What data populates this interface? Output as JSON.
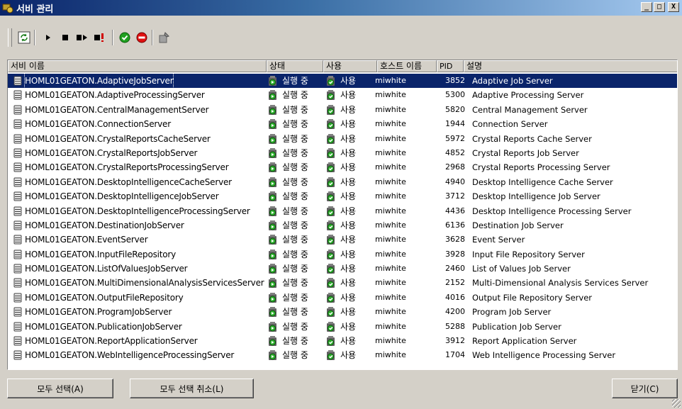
{
  "window": {
    "title": "서비 관리",
    "minimize": "_",
    "maximize": "□",
    "close": "X"
  },
  "toolbar": {
    "icons": [
      "refresh-icon",
      "start-icon",
      "stop-icon",
      "restart-icon",
      "force-stop-icon",
      "enable-icon",
      "disable-icon",
      "properties-icon"
    ]
  },
  "columns": {
    "name": "서비 이름",
    "state": "상태",
    "use": "사용",
    "host": "호스트 이름",
    "pid": "PID",
    "desc": "설명"
  },
  "rows": [
    {
      "name": "HOML01GEATON.AdaptiveJobServer",
      "state": "실행 중",
      "use": "사용",
      "host": "miwhite",
      "pid": "3852",
      "desc": "Adaptive Job Server",
      "selected": true
    },
    {
      "name": "HOML01GEATON.AdaptiveProcessingServer",
      "state": "실행 중",
      "use": "사용",
      "host": "miwhite",
      "pid": "5300",
      "desc": "Adaptive Processing Server"
    },
    {
      "name": "HOML01GEATON.CentralManagementServer",
      "state": "실행 중",
      "use": "사용",
      "host": "miwhite",
      "pid": "5820",
      "desc": "Central Management Server"
    },
    {
      "name": "HOML01GEATON.ConnectionServer",
      "state": "실행 중",
      "use": "사용",
      "host": "miwhite",
      "pid": "1944",
      "desc": "Connection Server"
    },
    {
      "name": "HOML01GEATON.CrystalReportsCacheServer",
      "state": "실행 중",
      "use": "사용",
      "host": "miwhite",
      "pid": "5972",
      "desc": "Crystal Reports Cache Server"
    },
    {
      "name": "HOML01GEATON.CrystalReportsJobServer",
      "state": "실행 중",
      "use": "사용",
      "host": "miwhite",
      "pid": "4852",
      "desc": "Crystal Reports Job Server"
    },
    {
      "name": "HOML01GEATON.CrystalReportsProcessingServer",
      "state": "실행 중",
      "use": "사용",
      "host": "miwhite",
      "pid": "2968",
      "desc": "Crystal Reports Processing Server"
    },
    {
      "name": "HOML01GEATON.DesktopIntelligenceCacheServer",
      "state": "실행 중",
      "use": "사용",
      "host": "miwhite",
      "pid": "4940",
      "desc": "Desktop Intelligence Cache Server"
    },
    {
      "name": "HOML01GEATON.DesktopIntelligenceJobServer",
      "state": "실행 중",
      "use": "사용",
      "host": "miwhite",
      "pid": "3712",
      "desc": "Desktop Intelligence Job Server"
    },
    {
      "name": "HOML01GEATON.DesktopIntelligenceProcessingServer",
      "state": "실행 중",
      "use": "사용",
      "host": "miwhite",
      "pid": "4436",
      "desc": "Desktop Intelligence Processing Server"
    },
    {
      "name": "HOML01GEATON.DestinationJobServer",
      "state": "실행 중",
      "use": "사용",
      "host": "miwhite",
      "pid": "6136",
      "desc": "Destination Job Server"
    },
    {
      "name": "HOML01GEATON.EventServer",
      "state": "실행 중",
      "use": "사용",
      "host": "miwhite",
      "pid": "3628",
      "desc": "Event Server"
    },
    {
      "name": "HOML01GEATON.InputFileRepository",
      "state": "실행 중",
      "use": "사용",
      "host": "miwhite",
      "pid": "3928",
      "desc": "Input File Repository Server"
    },
    {
      "name": "HOML01GEATON.ListOfValuesJobServer",
      "state": "실행 중",
      "use": "사용",
      "host": "miwhite",
      "pid": "2460",
      "desc": "List of Values Job Server"
    },
    {
      "name": "HOML01GEATON.MultiDimensionalAnalysisServicesServer",
      "state": "실행 중",
      "use": "사용",
      "host": "miwhite",
      "pid": "2152",
      "desc": "Multi-Dimensional Analysis Services Server"
    },
    {
      "name": "HOML01GEATON.OutputFileRepository",
      "state": "실행 중",
      "use": "사용",
      "host": "miwhite",
      "pid": "4016",
      "desc": "Output File Repository Server"
    },
    {
      "name": "HOML01GEATON.ProgramJobServer",
      "state": "실행 중",
      "use": "사용",
      "host": "miwhite",
      "pid": "4200",
      "desc": "Program Job Server"
    },
    {
      "name": "HOML01GEATON.PublicationJobServer",
      "state": "실행 중",
      "use": "사용",
      "host": "miwhite",
      "pid": "5288",
      "desc": "Publication Job Server"
    },
    {
      "name": "HOML01GEATON.ReportApplicationServer",
      "state": "실행 중",
      "use": "사용",
      "host": "miwhite",
      "pid": "3912",
      "desc": "Report Application Server"
    },
    {
      "name": "HOML01GEATON.WebIntelligenceProcessingServer",
      "state": "실행 중",
      "use": "사용",
      "host": "miwhite",
      "pid": "1704",
      "desc": "Web Intelligence Processing Server"
    }
  ],
  "buttons": {
    "select_all": "모두 선택(A)",
    "deselect_all": "모두 선택 취소(L)",
    "close": "닫기(C)"
  },
  "colors": {
    "selection": "#0a246a",
    "face": "#d4d0c8"
  }
}
